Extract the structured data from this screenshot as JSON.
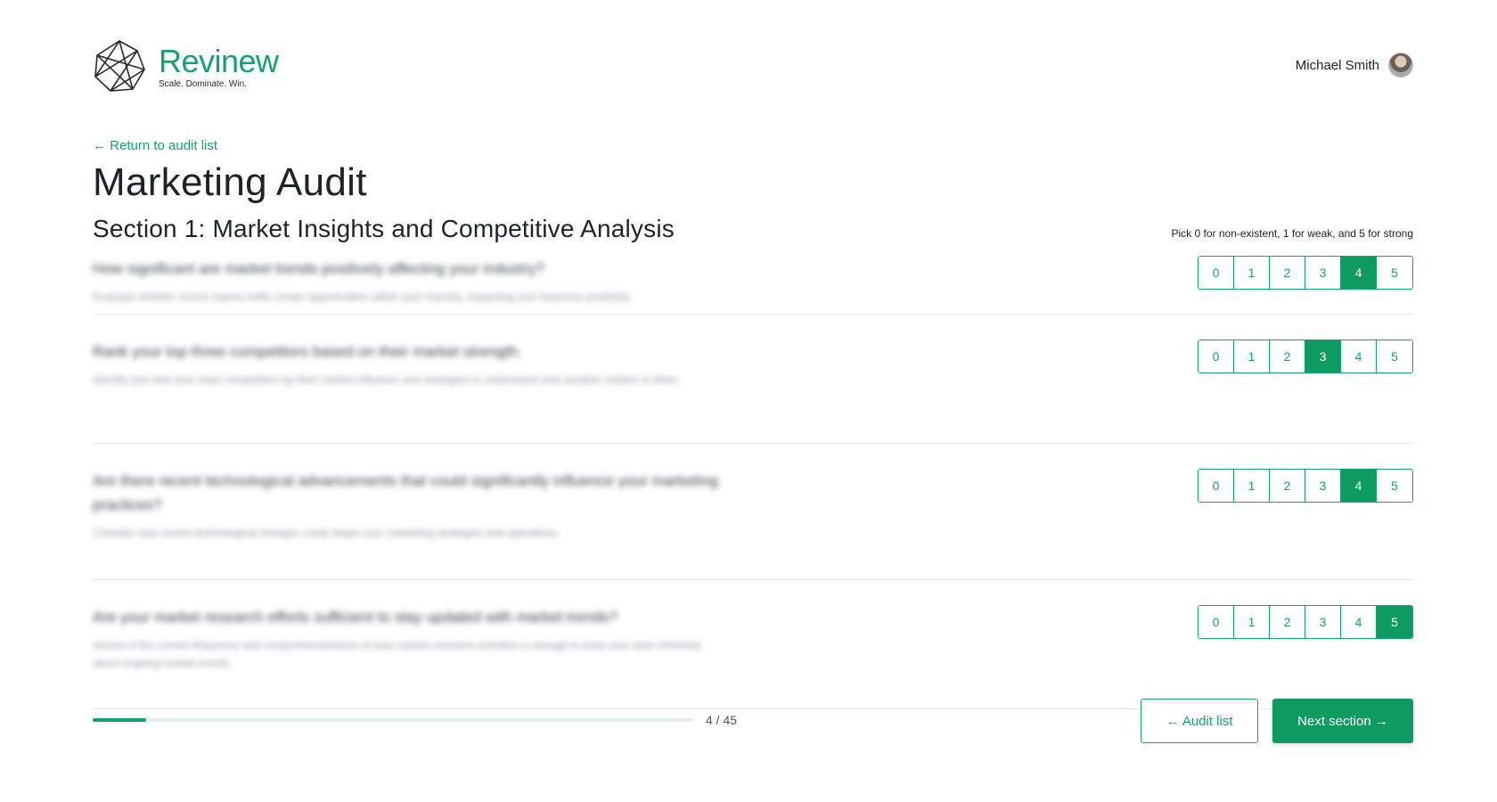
{
  "brand": {
    "name": "Revinew",
    "tagline": "Scale. Dominate. Win.",
    "accent": "#12a46b"
  },
  "user": {
    "name": "Michael Smith"
  },
  "nav": {
    "back_link": "← Return to audit list"
  },
  "page": {
    "title": "Marketing Audit",
    "section_title": "Section 1: Market Insights and Competitive Analysis",
    "hint": "Pick 0 for non-existent, 1 for weak, and 5 for strong"
  },
  "scale_options": [
    "0",
    "1",
    "2",
    "3",
    "4",
    "5"
  ],
  "questions": [
    {
      "title": "How significant are market trends positively affecting your industry?",
      "description": "Evaluate whether recent market shifts create opportunities within your industry, impacting your business positively.",
      "selected": "4"
    },
    {
      "title": "Rank your top three competitors based on their market strength.",
      "description": "Identify and rank your main competitors by their market influence and strategies to understand your position relative to them.",
      "selected": "3"
    },
    {
      "title": "Are there recent technological advancements that could significantly influence your marketing practices?",
      "description": "Consider how recent technological changes could shape your marketing strategies and operations.",
      "selected": "4"
    },
    {
      "title": "Are your market research efforts sufficient to stay updated with market trends?",
      "description": "Assess if the current frequency and comprehensiveness of your market research activities is enough to keep your team informed about ongoing market trends.",
      "selected": "5"
    }
  ],
  "progress": {
    "label": "4 / 45",
    "fraction": 0.0889
  },
  "footer": {
    "audit_list_label": "← Audit list",
    "next_label": "Next section →"
  }
}
